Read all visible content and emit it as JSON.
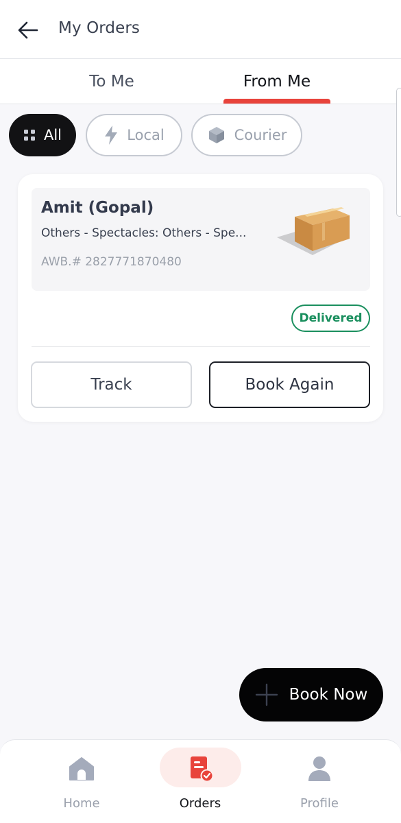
{
  "header": {
    "title": "My Orders",
    "back_icon": "arrow-left-icon"
  },
  "tabs": [
    {
      "label": "To Me",
      "active": false
    },
    {
      "label": "From Me",
      "active": true
    }
  ],
  "filters": [
    {
      "label": "All",
      "icon": "grid-icon",
      "selected": true
    },
    {
      "label": "Local",
      "icon": "lightning-icon",
      "selected": false
    },
    {
      "label": "Courier",
      "icon": "package-icon",
      "selected": false
    }
  ],
  "orders": [
    {
      "recipient": "Amit (Gopal)",
      "description": "Others - Spectacles: Others - Spe...",
      "awb": "AWB.# 2827771870480",
      "status": "Delivered",
      "track_label": "Track",
      "book_again_label": "Book Again"
    }
  ],
  "fab": {
    "label": "Book Now",
    "icon": "plus-icon"
  },
  "bottom_nav": [
    {
      "label": "Home",
      "icon": "home-icon",
      "active": false
    },
    {
      "label": "Orders",
      "icon": "orders-icon",
      "active": true
    },
    {
      "label": "Profile",
      "icon": "profile-icon",
      "active": false
    }
  ],
  "colors": {
    "accent": "#e8433b",
    "status_delivered": "#1a8f5e",
    "chip_selected": "#121214",
    "inactive": "#9aa0ac"
  }
}
